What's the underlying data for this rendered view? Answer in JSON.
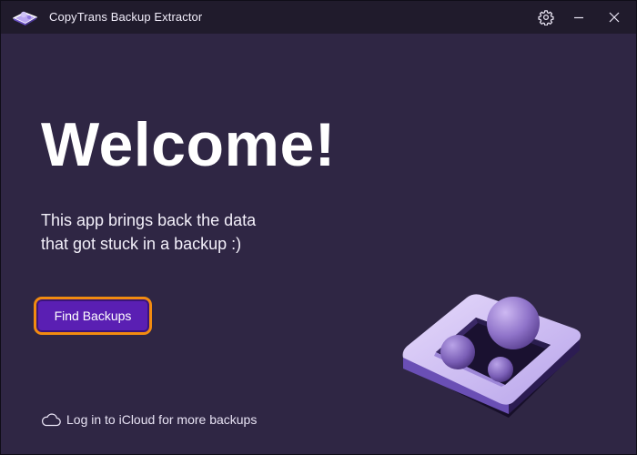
{
  "window": {
    "title": "CopyTrans Backup Extractor"
  },
  "icons": {
    "app": "copytrans-logo-icon",
    "settings": "gear-icon",
    "minimize": "minimize-icon",
    "close": "close-icon",
    "cloud": "cloud-icon",
    "hero": "backup-box-illustration"
  },
  "main": {
    "heading": "Welcome!",
    "subtitle_line1": "This app brings back the data",
    "subtitle_line2": "that got stuck in a backup :)",
    "find_button_label": "Find Backups",
    "icloud_link_label": "Log in to iCloud for more backups"
  },
  "colors": {
    "background": "#2f2644",
    "titlebar": "#201b2c",
    "button": "#5a1fb3",
    "button_focus_ring": "#f28b10"
  }
}
